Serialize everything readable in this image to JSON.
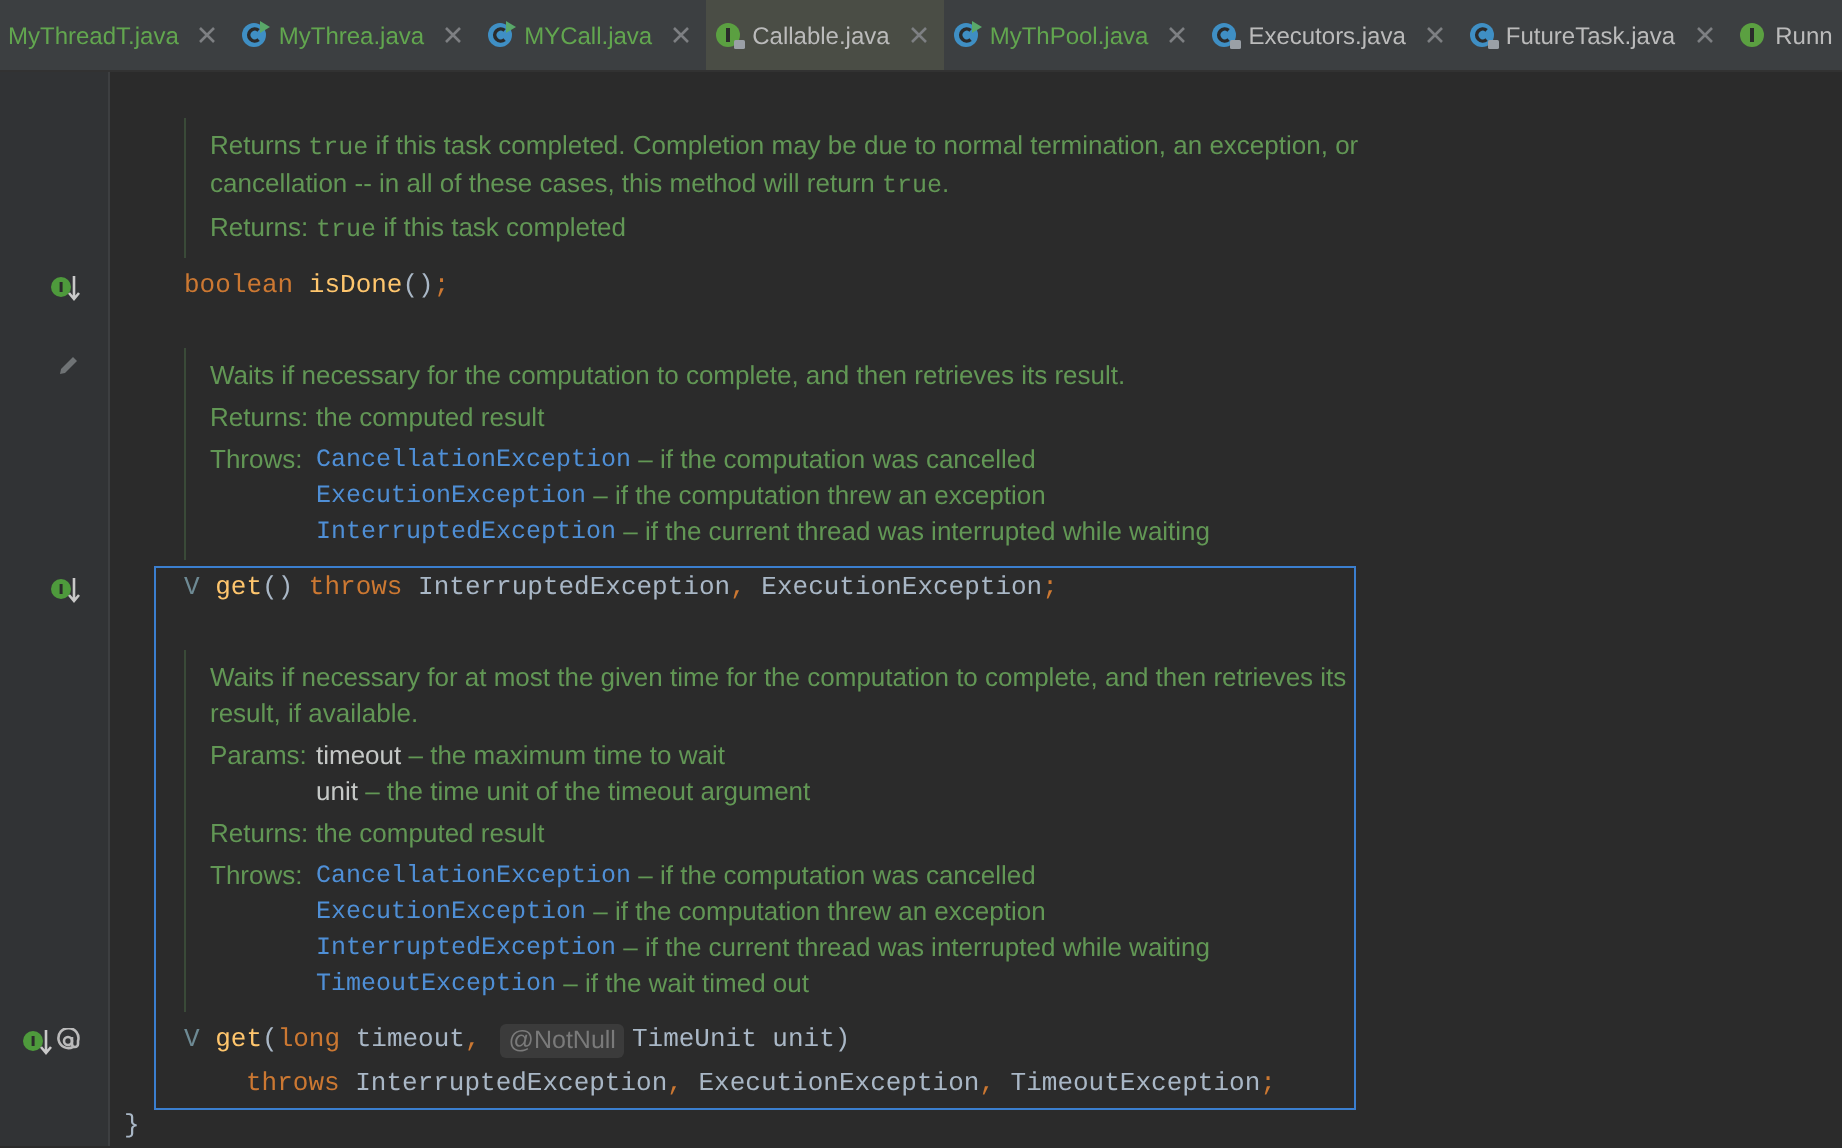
{
  "tabs": [
    {
      "label": "MyThreadT.java",
      "locked": false,
      "added": true,
      "selected": false,
      "closable": true
    },
    {
      "label": "MyThrea.java",
      "kind": "runnable",
      "locked": false,
      "added": true,
      "selected": false,
      "closable": true
    },
    {
      "label": "MYCall.java",
      "kind": "runnable",
      "locked": false,
      "added": true,
      "selected": false,
      "closable": true
    },
    {
      "label": "Callable.java",
      "kind": "interface",
      "locked": true,
      "added": false,
      "selected": true,
      "closable": true
    },
    {
      "label": "MyThPool.java",
      "kind": "runnable",
      "locked": false,
      "added": true,
      "selected": false,
      "closable": true
    },
    {
      "label": "Executors.java",
      "kind": "class",
      "locked": true,
      "added": false,
      "selected": false,
      "closable": true
    },
    {
      "label": "FutureTask.java",
      "kind": "class",
      "locked": true,
      "added": false,
      "selected": false,
      "closable": true
    },
    {
      "label": "Runn",
      "kind": "interface",
      "locked": false,
      "added": false,
      "selected": false,
      "closable": false
    }
  ],
  "editor": [
    {
      "kind": "doc",
      "description": [
        [
          {
            "t": "Returns ",
            "kind": "text"
          },
          {
            "t": "true",
            "kind": "code"
          },
          {
            "t": " if this task completed. Completion may be due to normal termination, an exception, or",
            "kind": "text"
          }
        ],
        [
          {
            "t": "cancellation -- in all of these cases, this method will return ",
            "kind": "text"
          },
          {
            "t": "true",
            "kind": "code"
          },
          {
            "t": ".",
            "kind": "text"
          }
        ]
      ],
      "sections": [
        {
          "label": "Returns:",
          "entries": [
            [
              {
                "t": "true",
                "kind": "code"
              },
              {
                "t": " if this task completed",
                "kind": "text"
              }
            ]
          ]
        }
      ]
    },
    {
      "kind": "code",
      "markers": [
        {
          "kind": "implements"
        }
      ],
      "segments": [
        {
          "t": "boolean ",
          "kind": "keyword"
        },
        {
          "t": "isDone",
          "kind": "method"
        },
        {
          "t": "()",
          "kind": "plain"
        },
        {
          "t": ";",
          "kind": "keyword"
        }
      ]
    },
    {
      "kind": "doc",
      "markers": [
        {
          "kind": "edit"
        }
      ],
      "description": [
        [
          {
            "t": "Waits if necessary for the computation to complete, and then retrieves its result.",
            "kind": "text"
          }
        ]
      ],
      "sections": [
        {
          "label": "Returns:",
          "entries": [
            [
              {
                "t": "the computed result",
                "kind": "text"
              }
            ]
          ]
        },
        {
          "label": "Throws:",
          "entries": [
            [
              {
                "t": "CancellationException",
                "kind": "link"
              },
              {
                "t": " – if the computation was cancelled",
                "kind": "text"
              }
            ],
            [
              {
                "t": "ExecutionException",
                "kind": "link"
              },
              {
                "t": " – if the computation threw an exception",
                "kind": "text"
              }
            ],
            [
              {
                "t": "InterruptedException",
                "kind": "link"
              },
              {
                "t": " – if the current thread was interrupted while waiting",
                "kind": "text"
              }
            ]
          ]
        }
      ]
    },
    {
      "kind": "frame",
      "children": [
        {
          "kind": "code",
          "markers": [
            {
              "kind": "implements"
            }
          ],
          "segments": [
            {
              "t": "V ",
              "kind": "type"
            },
            {
              "t": "get",
              "kind": "method"
            },
            {
              "t": "() ",
              "kind": "plain"
            },
            {
              "t": "throws",
              "kind": "keyword"
            },
            {
              "t": " InterruptedException",
              "kind": "plain"
            },
            {
              "t": ",",
              "kind": "keyword"
            },
            {
              "t": " ExecutionException",
              "kind": "plain"
            },
            {
              "t": ";",
              "kind": "keyword"
            }
          ]
        },
        {
          "kind": "doc",
          "description": [
            [
              {
                "t": "Waits if necessary for at most the given time for the computation to complete, and then retrieves its",
                "kind": "text"
              }
            ],
            [
              {
                "t": "result, if available.",
                "kind": "text"
              }
            ]
          ],
          "sections": [
            {
              "label": "Params:",
              "entries": [
                [
                  {
                    "t": "timeout",
                    "kind": "param"
                  },
                  {
                    "t": " – the maximum time to wait",
                    "kind": "text"
                  }
                ],
                [
                  {
                    "t": "unit",
                    "kind": "param"
                  },
                  {
                    "t": " – the time unit of the timeout argument",
                    "kind": "text"
                  }
                ]
              ]
            },
            {
              "label": "Returns:",
              "entries": [
                [
                  {
                    "t": "the computed result",
                    "kind": "text"
                  }
                ]
              ]
            },
            {
              "label": "Throws:",
              "entries": [
                [
                  {
                    "t": "CancellationException",
                    "kind": "link"
                  },
                  {
                    "t": " – if the computation was cancelled",
                    "kind": "text"
                  }
                ],
                [
                  {
                    "t": "ExecutionException",
                    "kind": "link"
                  },
                  {
                    "t": " – if the computation threw an exception",
                    "kind": "text"
                  }
                ],
                [
                  {
                    "t": "InterruptedException",
                    "kind": "link"
                  },
                  {
                    "t": " – if the current thread was interrupted while waiting",
                    "kind": "text"
                  }
                ],
                [
                  {
                    "t": "TimeoutException",
                    "kind": "link"
                  },
                  {
                    "t": " – if the wait timed out",
                    "kind": "text"
                  }
                ]
              ]
            }
          ]
        },
        {
          "kind": "code",
          "markers": [
            {
              "kind": "implements"
            },
            {
              "kind": "annotation"
            }
          ],
          "segments": [
            {
              "t": "V ",
              "kind": "type"
            },
            {
              "t": "get",
              "kind": "method"
            },
            {
              "t": "(",
              "kind": "plain"
            },
            {
              "t": "long",
              "kind": "keyword"
            },
            {
              "t": " timeout",
              "kind": "plain"
            },
            {
              "t": ",",
              "kind": "keyword"
            },
            {
              "t": "@NotNull",
              "kind": "hint"
            },
            {
              "t": "TimeUnit unit)",
              "kind": "plain"
            }
          ]
        },
        {
          "kind": "continuation",
          "segments": [
            {
              "t": "throws",
              "kind": "keyword"
            },
            {
              "t": " InterruptedException",
              "kind": "plain"
            },
            {
              "t": ",",
              "kind": "keyword"
            },
            {
              "t": " ExecutionException",
              "kind": "plain"
            },
            {
              "t": ",",
              "kind": "keyword"
            },
            {
              "t": " TimeoutException",
              "kind": "plain"
            },
            {
              "t": ";",
              "kind": "keyword"
            }
          ]
        }
      ]
    },
    {
      "kind": "brace",
      "segments": [
        {
          "t": "}",
          "kind": "plain"
        }
      ]
    }
  ]
}
